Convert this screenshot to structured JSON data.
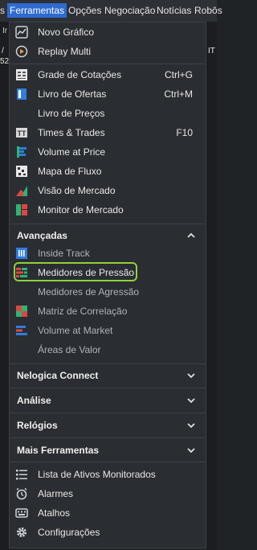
{
  "menubar": {
    "items": [
      "s",
      "Ferramentas",
      "Opções",
      "Negociação",
      "Notícias",
      "Robôs"
    ],
    "active_index": 1
  },
  "background_fragments": [
    "Ir",
    "/",
    "52",
    "IT"
  ],
  "menu": {
    "group1": [
      {
        "label": "Novo Gráfico",
        "icon": "chart-line-icon"
      },
      {
        "label": "Replay Multi",
        "icon": "replay-icon"
      }
    ],
    "group2": [
      {
        "label": "Grade de Cotações",
        "shortcut": "Ctrl+G",
        "icon": "quote-grid-icon"
      },
      {
        "label": "Livro de Ofertas",
        "shortcut": "Ctrl+M",
        "icon": "order-book-icon"
      },
      {
        "label": "Livro de Preços",
        "icon": ""
      },
      {
        "label": "Times & Trades",
        "shortcut": "F10",
        "icon": "times-trades-icon"
      },
      {
        "label": "Volume at Price",
        "icon": "volume-at-price-icon"
      },
      {
        "label": "Mapa de Fluxo",
        "icon": "flow-map-icon"
      },
      {
        "label": "Visão de Mercado",
        "icon": "market-view-icon"
      },
      {
        "label": "Monitor de Mercado",
        "icon": "market-monitor-icon"
      }
    ],
    "advanced": {
      "title": "Avançadas",
      "items": [
        {
          "label": "Inside Track",
          "icon": "inside-track-icon"
        },
        {
          "label": "Medidores de Pressão",
          "icon": "pressure-gauge-icon"
        },
        {
          "label": "Medidores de Agressão",
          "icon": ""
        },
        {
          "label": "Matriz de Correlação",
          "icon": "correlation-matrix-icon"
        },
        {
          "label": "Volume at Market",
          "icon": "volume-at-market-icon"
        },
        {
          "label": "Áreas de Valor",
          "icon": ""
        }
      ]
    },
    "sections": [
      "Nelogica Connect",
      "Análise",
      "Relógios",
      "Mais Ferramentas"
    ],
    "group_bottom": [
      {
        "label": "Lista de Ativos Monitorados",
        "icon": "list-icon"
      },
      {
        "label": "Alarmes",
        "icon": "alarm-clock-icon"
      },
      {
        "label": "Atalhos",
        "icon": "keyboard-icon"
      },
      {
        "label": "Configurações",
        "icon": "gear-icon"
      }
    ]
  },
  "colors": {
    "menu_bg": "#2a2d31",
    "active_menu": "#2e6bd1",
    "highlight_outline": "#8fd13c",
    "icon_blue": "#2f7de1",
    "icon_green": "#2bb673",
    "icon_red": "#e04545"
  }
}
